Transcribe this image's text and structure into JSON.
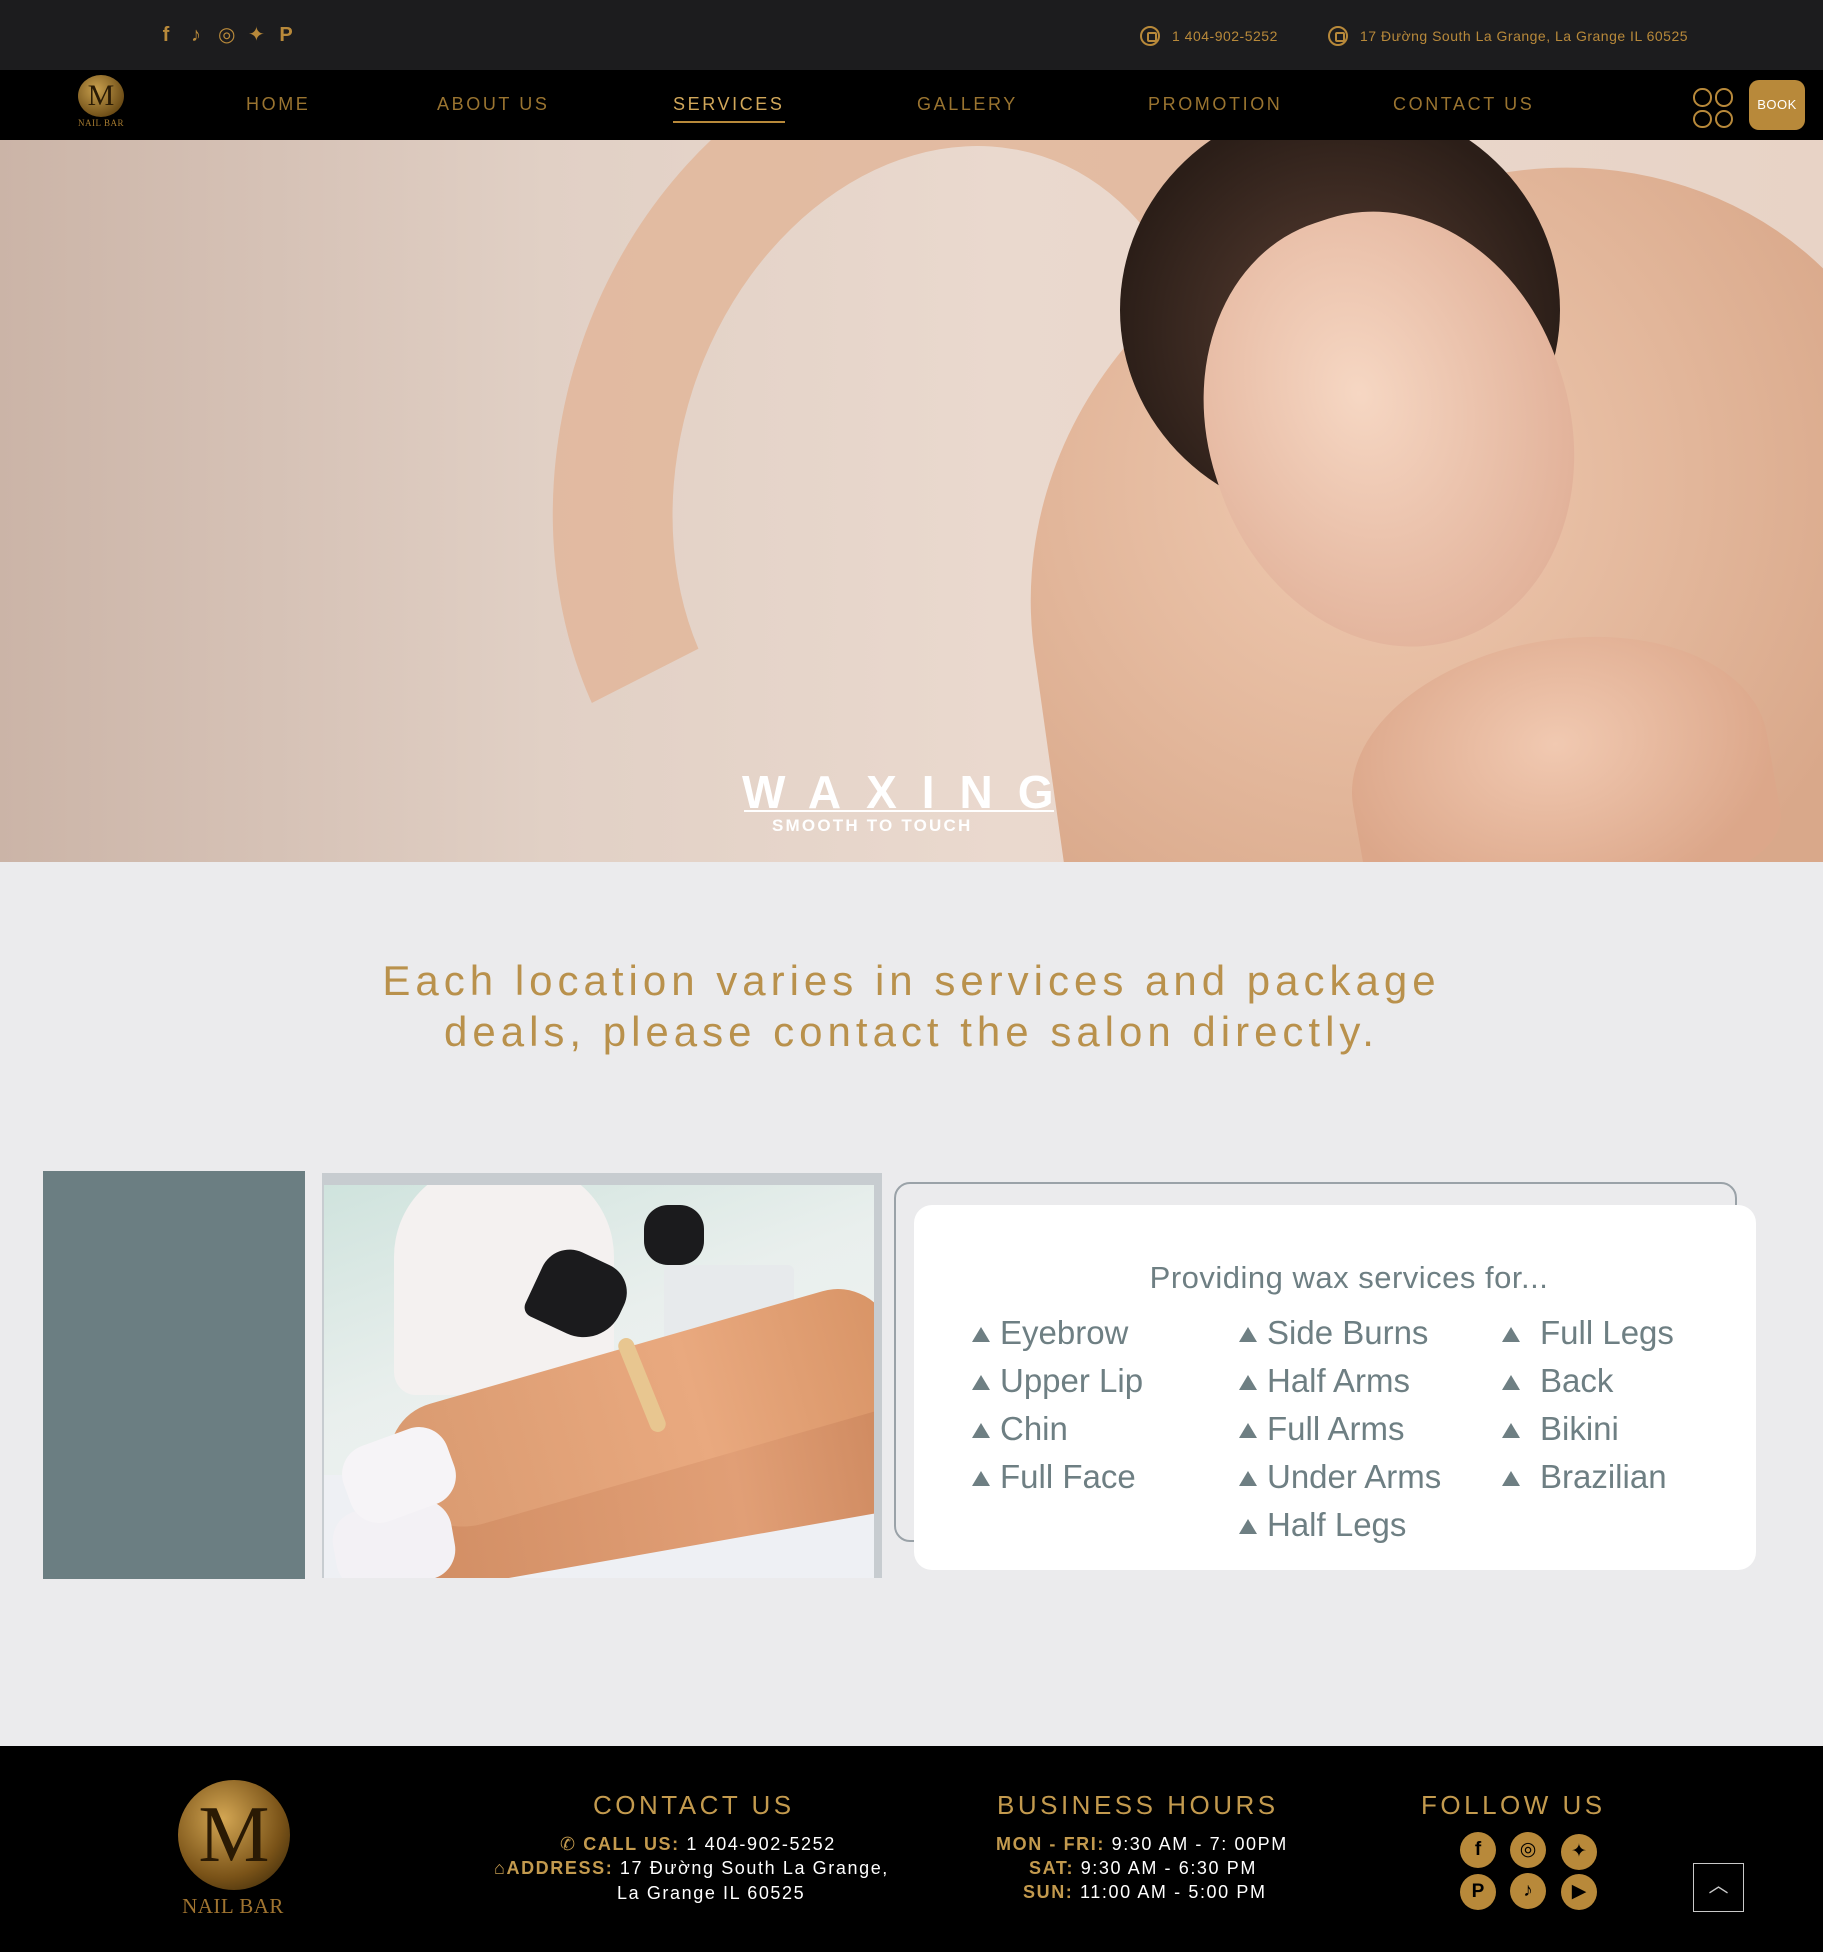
{
  "topbar": {
    "social": [
      {
        "name": "facebook-icon",
        "glyph": "f"
      },
      {
        "name": "tiktok-icon",
        "glyph": "♪"
      },
      {
        "name": "instagram-icon",
        "glyph": "◎"
      },
      {
        "name": "twitter-icon",
        "glyph": "✦"
      },
      {
        "name": "pinterest-icon",
        "glyph": "P"
      }
    ],
    "phone": "1 404-902-5252",
    "address": "17 Đường South La Grange, La Grange IL 60525"
  },
  "nav": {
    "logo_text": "NAIL BAR",
    "logo_letter": "M",
    "items": [
      "HOME",
      "ABOUT US",
      "SERVICES",
      "GALLERY",
      "PROMOTION",
      "CONTACT US"
    ],
    "active": "SERVICES",
    "book_label": "BOOK"
  },
  "hero": {
    "title": "WAXING",
    "subtitle": "SMOOTH TO TOUCH"
  },
  "notice": {
    "line1": "Each location varies in services and package",
    "line2": "deals, please contact the salon directly."
  },
  "services": {
    "title": "Providing wax services for...",
    "col1": [
      "Eyebrow",
      "Upper Lip",
      "Chin",
      "Full Face"
    ],
    "col2": [
      "Side Burns",
      "Half Arms",
      "Full Arms",
      "Under Arms",
      "Half Legs"
    ],
    "col3": [
      "Full Legs",
      "Back",
      "Bikini",
      "Brazilian"
    ]
  },
  "footer": {
    "logo_letter": "M",
    "logo_text": "NAIL BAR",
    "contact_heading": "CONTACT US",
    "call_label": "CALL US:",
    "call_value": "1 404-902-5252",
    "address_label": "ADDRESS:",
    "address_line1": "17 Đường South La Grange,",
    "address_line2": "La Grange IL 60525",
    "hours_heading": "BUSINESS HOURS",
    "hours": [
      {
        "day": "MON - FRI:",
        "time": "9:30 AM - 7: 00PM"
      },
      {
        "day": "SAT:",
        "time": "9:30 AM - 6:30 PM"
      },
      {
        "day": "SUN:",
        "time": "11:00 AM - 5:00 PM"
      }
    ],
    "follow_heading": "FOLLOW US",
    "follow_icons": [
      {
        "name": "facebook-icon",
        "glyph": "f"
      },
      {
        "name": "instagram-icon",
        "glyph": "◎"
      },
      {
        "name": "twitter-icon",
        "glyph": "✦"
      },
      {
        "name": "pinterest-icon",
        "glyph": "P"
      },
      {
        "name": "tiktok-icon",
        "glyph": "♪"
      },
      {
        "name": "youtube-icon",
        "glyph": "▶"
      }
    ],
    "back_to_top_glyph": "︿"
  },
  "colors": {
    "gold": "#b8893a",
    "slate": "#6b7e82",
    "background": "#ebebed",
    "dark": "#000000"
  }
}
